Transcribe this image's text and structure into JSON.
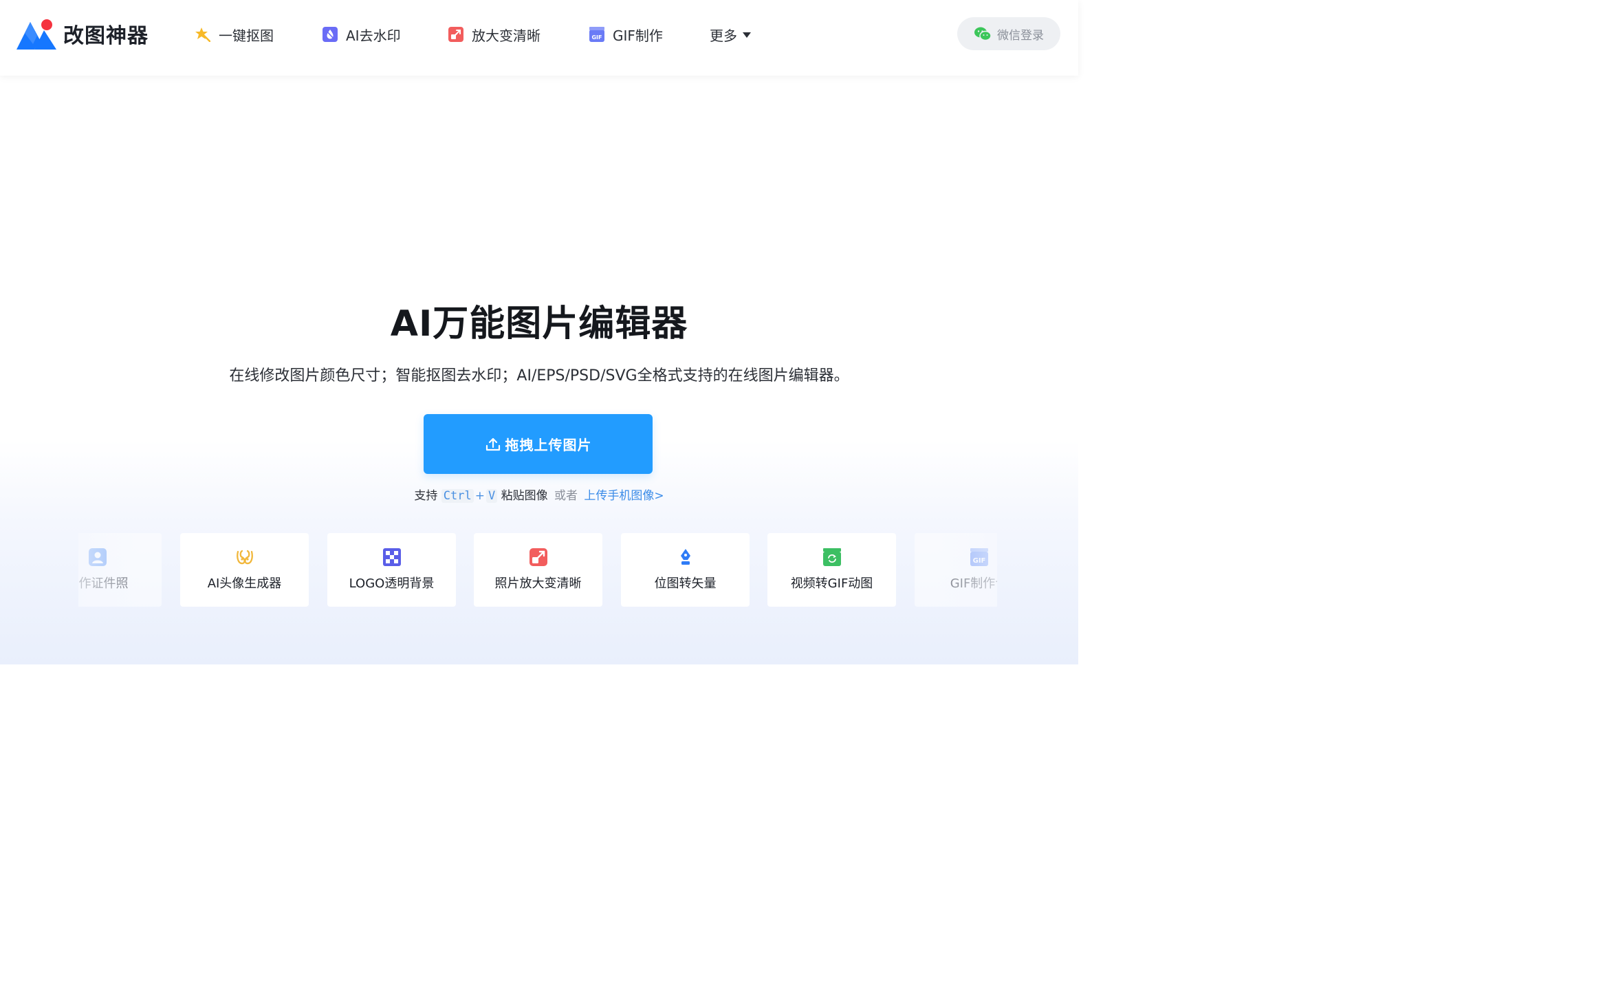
{
  "brand": {
    "name": "改图神器"
  },
  "nav": {
    "items": [
      {
        "label": "一键抠图",
        "icon": "magic-wand-icon"
      },
      {
        "label": "AI去水印",
        "icon": "watermark-drop-icon"
      },
      {
        "label": "放大变清晰",
        "icon": "enlarge-icon"
      },
      {
        "label": "GIF制作",
        "icon": "gif-clapper-icon"
      }
    ],
    "more_label": "更多",
    "login_label": "微信登录"
  },
  "hero": {
    "title": "AI万能图片编辑器",
    "subtitle": "在线修改图片颜色尺寸；智能抠图去水印；AI/EPS/PSD/SVG全格式支持的在线图片编辑器。",
    "upload_label": "拖拽上传图片",
    "hint": {
      "support": "支持",
      "key1": "Ctrl",
      "plus": "+",
      "key2": "V",
      "paste": "粘贴图像",
      "or": "或者",
      "mobile_link": "上传手机图像>"
    }
  },
  "features": [
    {
      "label": "制作证件照",
      "icon": "id-photo-icon"
    },
    {
      "label": "AI头像生成器",
      "icon": "avatar-generator-icon"
    },
    {
      "label": "LOGO透明背景",
      "icon": "transparent-grid-icon"
    },
    {
      "label": "照片放大变清晰",
      "icon": "enlarge-icon"
    },
    {
      "label": "位图转矢量",
      "icon": "pen-nib-icon"
    },
    {
      "label": "视频转GIF动图",
      "icon": "video-gif-icon"
    },
    {
      "label": "GIF制作合",
      "icon": "gif-clapper-icon"
    }
  ],
  "colors": {
    "primary": "#229cff",
    "link": "#3b8ce8",
    "brand_blue": "#1677ff",
    "brand_red": "#f5333f",
    "wechat_green": "#3cc65a"
  }
}
